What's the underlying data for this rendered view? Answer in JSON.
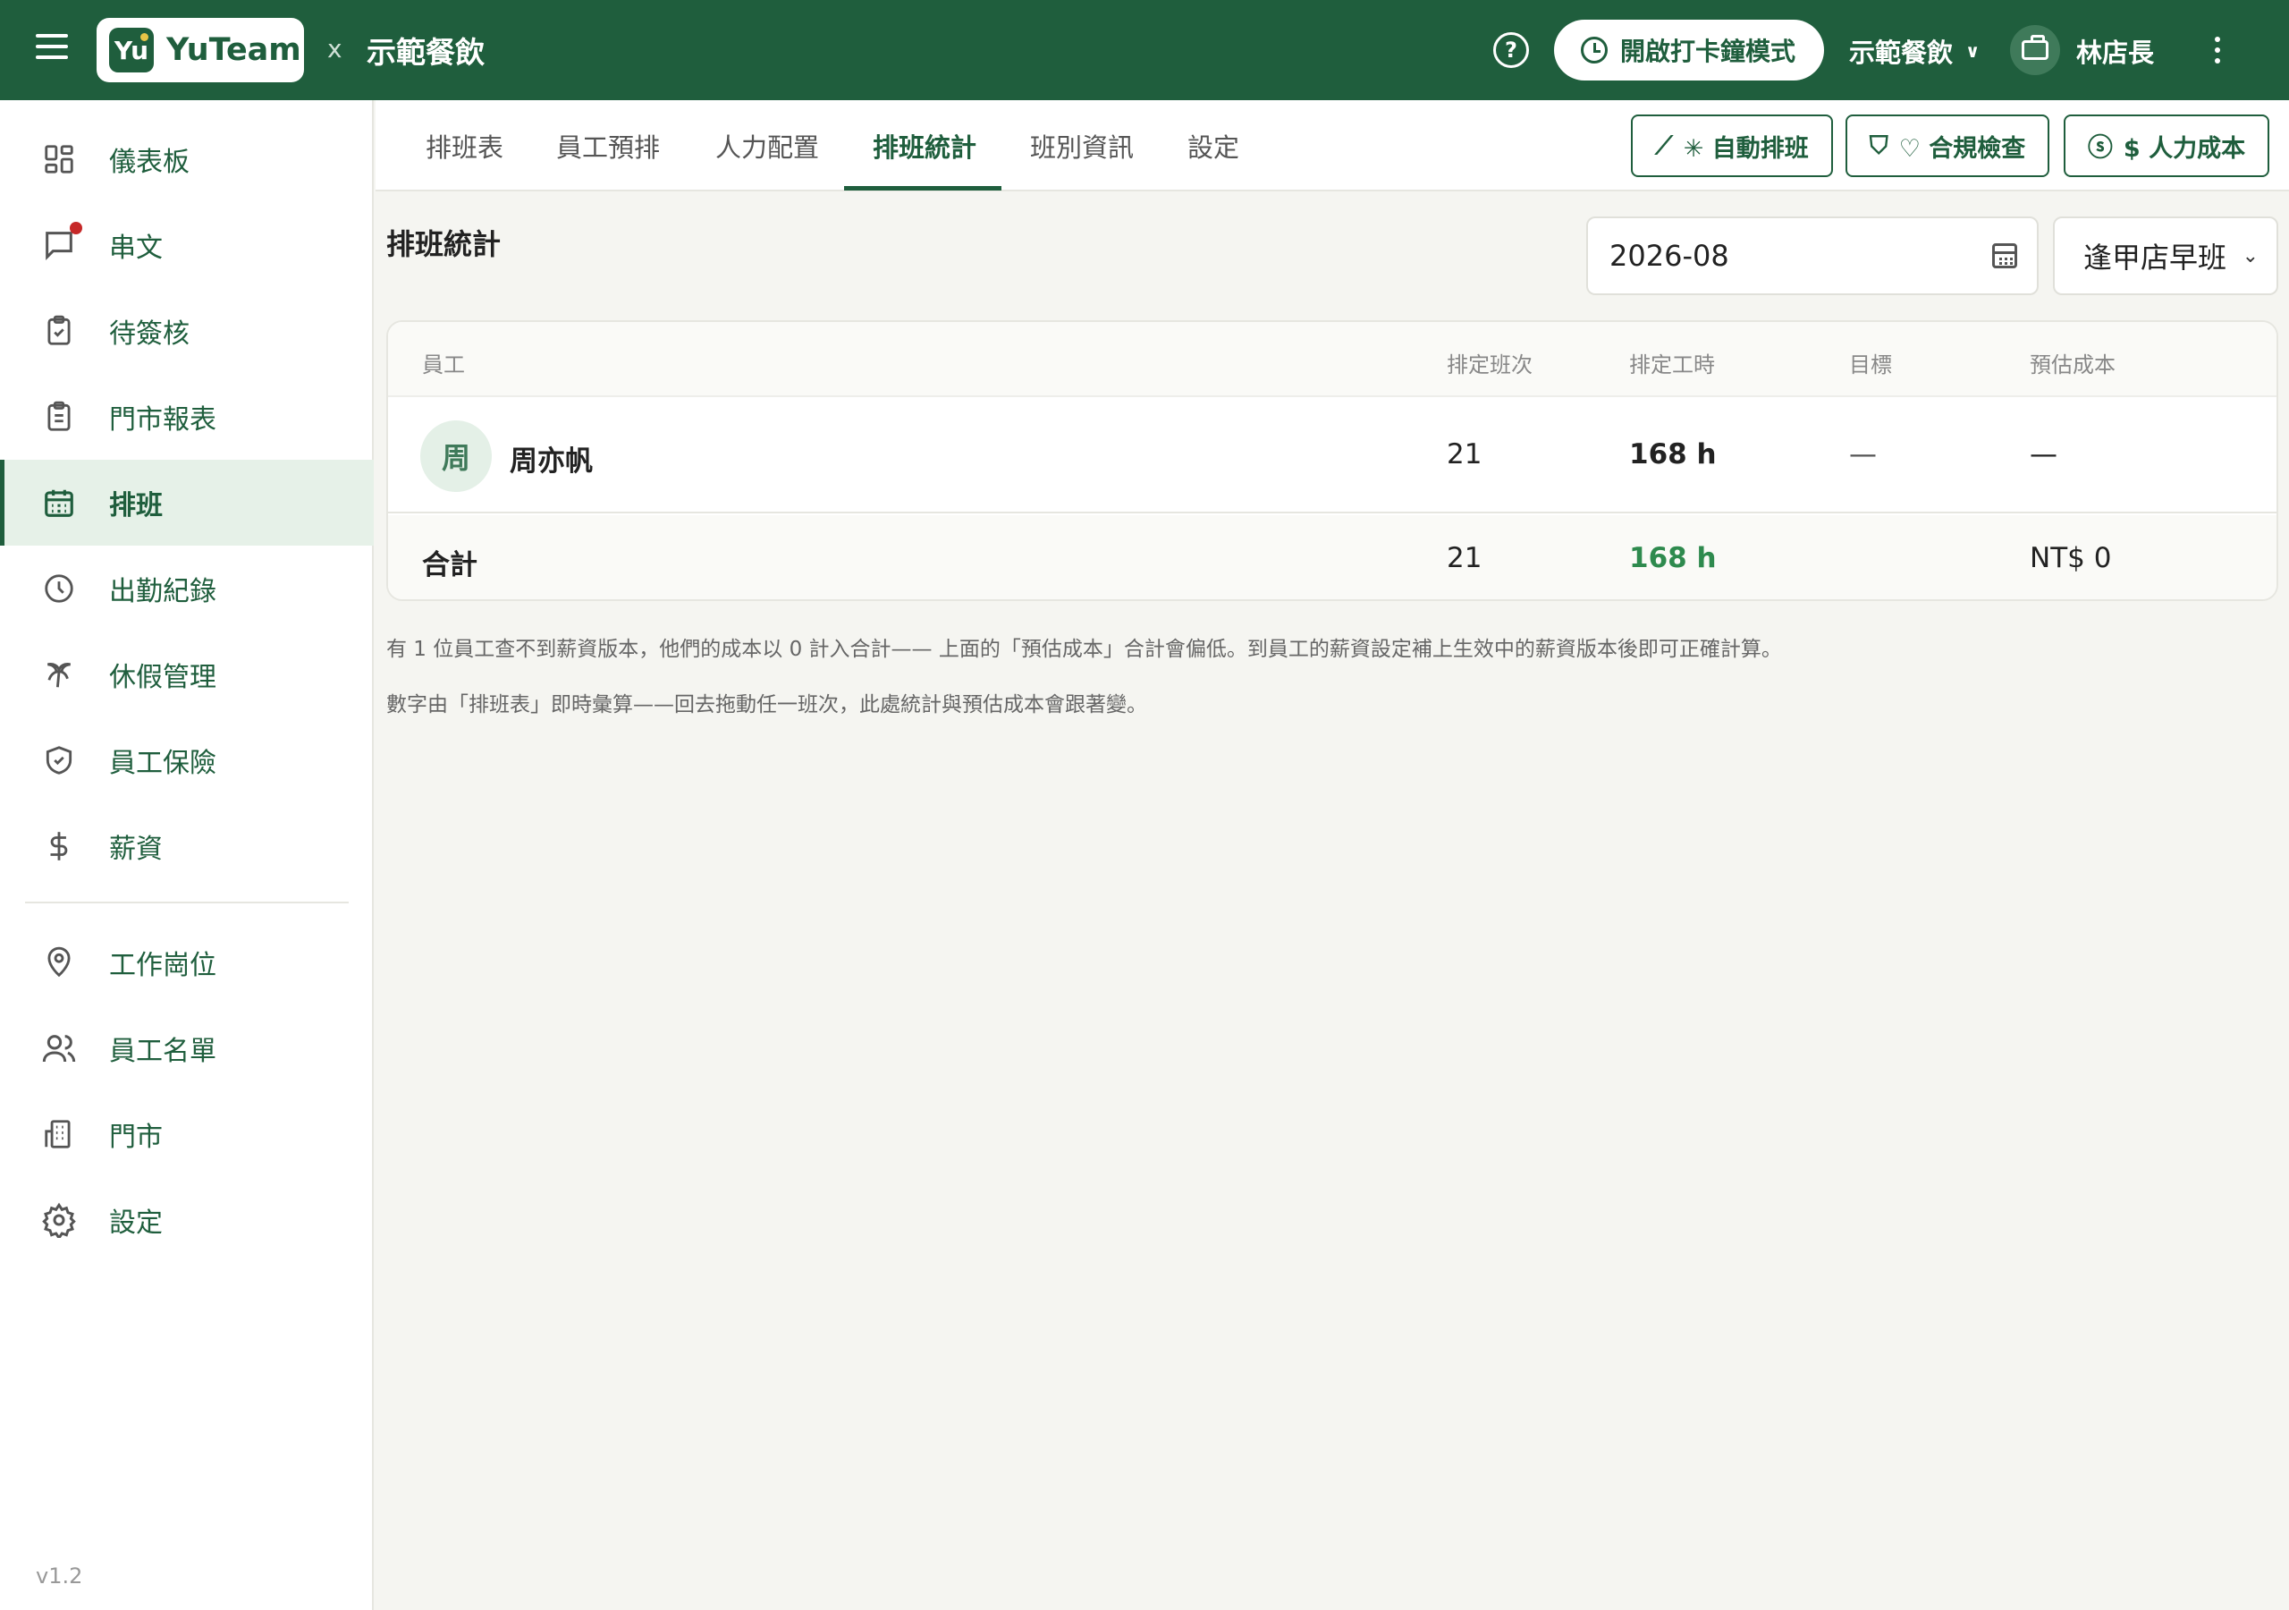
{
  "header": {
    "logo_badge": "Yu",
    "logo_text": "YuTeam",
    "separator": "x",
    "org_name": "示範餐飲",
    "clock_button": "開啟打卡鐘模式",
    "org_select": "示範餐飲",
    "user_name": "林店長"
  },
  "sidebar": {
    "items": [
      {
        "label": "儀表板",
        "icon": "dashboard-icon"
      },
      {
        "label": "串文",
        "icon": "message-icon"
      },
      {
        "label": "待簽核",
        "icon": "clipboard-check-icon"
      },
      {
        "label": "門市報表",
        "icon": "report-icon"
      },
      {
        "label": "排班",
        "icon": "calendar-icon"
      },
      {
        "label": "出勤紀錄",
        "icon": "clock-icon"
      },
      {
        "label": "休假管理",
        "icon": "palm-tree-icon"
      },
      {
        "label": "員工保險",
        "icon": "shield-icon"
      },
      {
        "label": "薪資",
        "icon": "dollar-icon"
      },
      {
        "label": "工作崗位",
        "icon": "map-pin-icon"
      },
      {
        "label": "員工名單",
        "icon": "users-icon"
      },
      {
        "label": "門市",
        "icon": "building-icon"
      },
      {
        "label": "設定",
        "icon": "gear-icon"
      }
    ],
    "active": "排班",
    "version": "v1.2"
  },
  "tabs": [
    {
      "label": "排班表"
    },
    {
      "label": "員工預排"
    },
    {
      "label": "人力配置"
    },
    {
      "label": "排班統計"
    },
    {
      "label": "班別資訊"
    },
    {
      "label": "設定"
    }
  ],
  "actions": {
    "auto_schedule": "✳ 自動排班",
    "compliance": "♡ 合規檢查",
    "labor_cost": "$ 人力成本"
  },
  "page": {
    "title": "排班統計",
    "month": "2026-08",
    "shift": "逢甲店早班"
  },
  "table": {
    "headers": {
      "employee": "員工",
      "shifts": "排定班次",
      "hours": "排定工時",
      "target": "目標",
      "cost": "預估成本"
    },
    "rows": [
      {
        "avatar": "周",
        "name": "周亦帆",
        "shifts": "21",
        "hours": "168 h",
        "target": "—",
        "cost": "—"
      }
    ],
    "total": {
      "label": "合計",
      "shifts": "21",
      "hours": "168 h",
      "cost": "NT$ 0"
    }
  },
  "notes": [
    "有 1 位員工查不到薪資版本，他們的成本以 0 計入合計—— 上面的「預估成本」合計會偏低。到員工的薪資設定補上生效中的薪資版本後即可正確計算。",
    "數字由「排班表」即時彙算——回去拖動任一班次，此處統計與預估成本會跟著變。"
  ],
  "colors": {
    "brand": "#1f5e3d",
    "accent_green": "#2e8a4e",
    "active_bg": "#e6f1e8",
    "notification": "#c62828"
  }
}
